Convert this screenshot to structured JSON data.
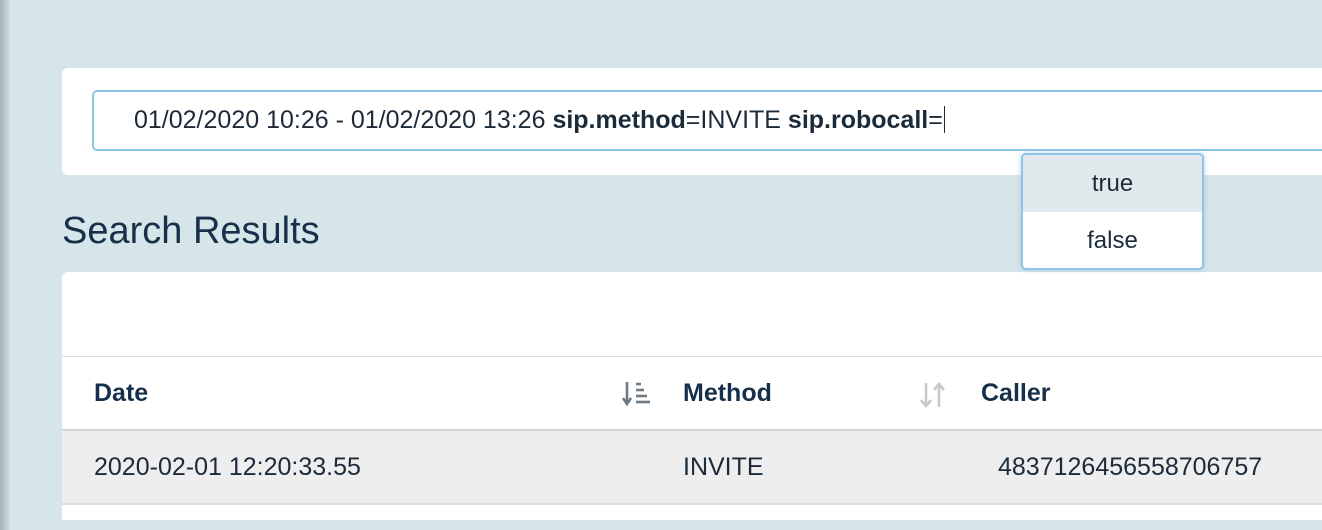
{
  "search": {
    "date_range": "01/02/2020 10:26 - 01/02/2020 13:26",
    "filters": [
      {
        "key": "sip.method",
        "op": "=",
        "value": "INVITE"
      },
      {
        "key": "sip.robocall",
        "op": "=",
        "value": ""
      }
    ]
  },
  "autocomplete": {
    "options": [
      "true",
      "false"
    ],
    "highlighted": "true"
  },
  "results": {
    "title": "Search Results",
    "columns": [
      {
        "label": "Date",
        "sort_icon": "sort-descending-icon"
      },
      {
        "label": "Method",
        "sort_icon": "sort-both-icon"
      },
      {
        "label": "Caller",
        "sort_icon": ""
      }
    ],
    "rows": [
      {
        "date": "2020-02-01 12:20:33.55",
        "method": "INVITE",
        "caller": "4837126456558706757"
      }
    ]
  },
  "colors": {
    "background": "#d6e5ea",
    "accent_border": "#8ec4e6",
    "text": "#1c2b3a",
    "row_bg": "#eeeeee"
  }
}
